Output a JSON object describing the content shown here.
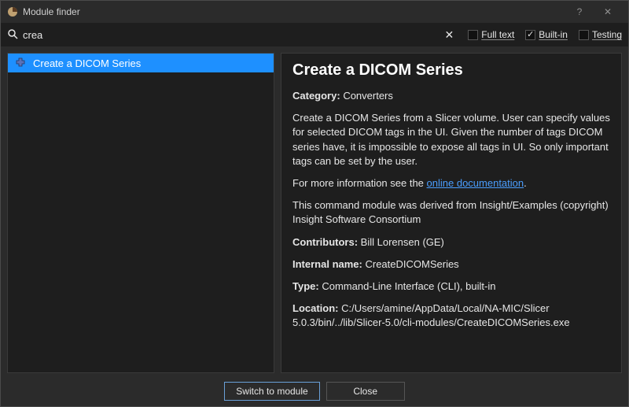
{
  "window": {
    "title": "Module finder"
  },
  "search": {
    "value": "crea",
    "placeholder": ""
  },
  "filters": {
    "fulltext": {
      "label": "Full text",
      "checked": false
    },
    "builtin": {
      "label": "Built-in",
      "checked": true
    },
    "testing": {
      "label": "Testing",
      "checked": false
    }
  },
  "results": [
    {
      "label": "Create a DICOM Series",
      "selected": true
    }
  ],
  "detail": {
    "title": "Create a DICOM Series",
    "category_label": "Category:",
    "category_value": "Converters",
    "description": "Create a DICOM Series from a Slicer volume. User can specify values for selected DICOM tags in the UI. Given the number of tags DICOM series have, it is impossible to expose all tags in UI. So only important tags can be set by the user.",
    "moreinfo_prefix": "For more information see the ",
    "moreinfo_link": "online documentation",
    "moreinfo_suffix": ".",
    "derived": "This command module was derived from Insight/Examples (copyright) Insight Software Consortium",
    "contributors_label": "Contributors:",
    "contributors_value": "Bill Lorensen (GE)",
    "internal_label": "Internal name:",
    "internal_value": "CreateDICOMSeries",
    "type_label": "Type:",
    "type_value": "Command-Line Interface (CLI), built-in",
    "location_label": "Location:",
    "location_value": "C:/Users/amine/AppData/Local/NA-MIC/Slicer 5.0.3/bin/../lib/Slicer-5.0/cli-modules/CreateDICOMSeries.exe"
  },
  "footer": {
    "switch": "Switch to module",
    "close": "Close"
  },
  "titlebar_buttons": {
    "help": "?",
    "close": "✕"
  }
}
